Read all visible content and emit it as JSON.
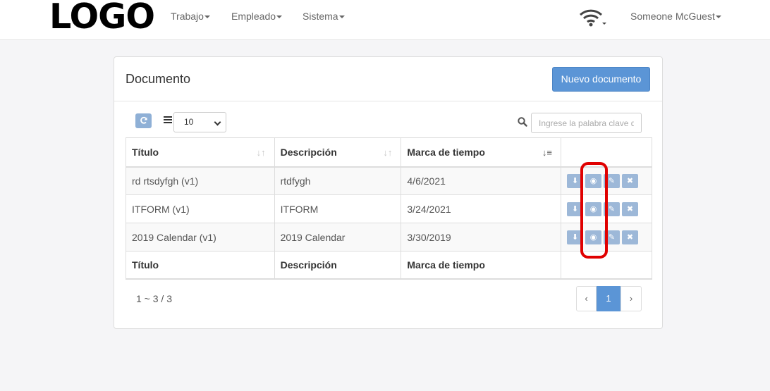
{
  "nav": {
    "logo": "LOGO",
    "menu": [
      {
        "label": "Trabajo"
      },
      {
        "label": "Empleado"
      },
      {
        "label": "Sistema"
      }
    ],
    "user": "Someone McGuest"
  },
  "panel": {
    "title": "Documento",
    "new_button": "Nuevo documento"
  },
  "toolbar": {
    "page_size": "10",
    "search_placeholder": "Ingrese la palabra clave d"
  },
  "table": {
    "headers": [
      "Título",
      "Descripción",
      "Marca de tiempo"
    ],
    "rows": [
      {
        "title": "rd rtsdyfgh (v1)",
        "description": "rtdfygh",
        "date": "4/6/2021"
      },
      {
        "title": "ITFORM (v1)",
        "description": "ITFORM",
        "date": "3/24/2021"
      },
      {
        "title": "2019 Calendar (v1)",
        "description": "2019 Calendar",
        "date": "3/30/2019"
      }
    ]
  },
  "pagination": {
    "range": "1 ~ 3 / 3",
    "prev": "‹",
    "current": "1",
    "next": "›"
  },
  "colors": {
    "primary": "#5b95d6",
    "action_button": "#9db8d8",
    "highlight": "#e00000"
  }
}
